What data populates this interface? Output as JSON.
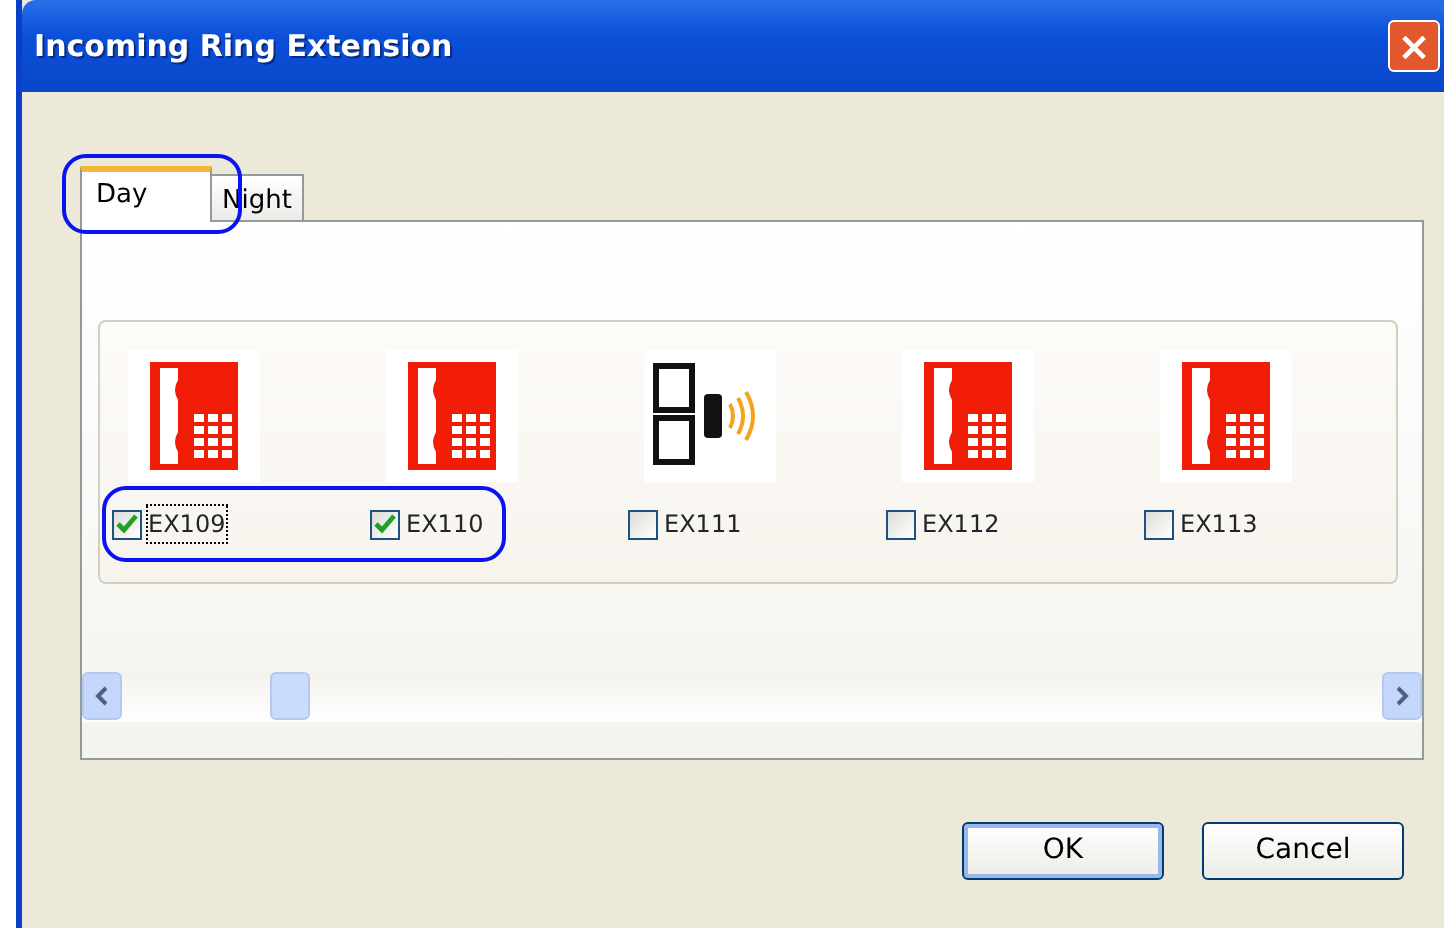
{
  "window": {
    "title": "Incoming Ring Extension",
    "close": "×"
  },
  "tabs": [
    {
      "label": "Day",
      "selected": true,
      "highlighted": true
    },
    {
      "label": "Night",
      "selected": false,
      "highlighted": false
    }
  ],
  "extensions": [
    {
      "label": "EX109",
      "kind": "phone",
      "checked": true,
      "focused": true,
      "highlighted": true
    },
    {
      "label": "EX110",
      "kind": "phone",
      "checked": true,
      "focused": false,
      "highlighted": true
    },
    {
      "label": "EX111",
      "kind": "wireless",
      "checked": false,
      "focused": false,
      "highlighted": false
    },
    {
      "label": "EX112",
      "kind": "phone",
      "checked": false,
      "focused": false,
      "highlighted": false
    },
    {
      "label": "EX113",
      "kind": "phone",
      "checked": false,
      "focused": false,
      "highlighted": false
    }
  ],
  "buttons": [
    {
      "label": "OK",
      "default": true
    },
    {
      "label": "Cancel",
      "default": false
    }
  ]
}
